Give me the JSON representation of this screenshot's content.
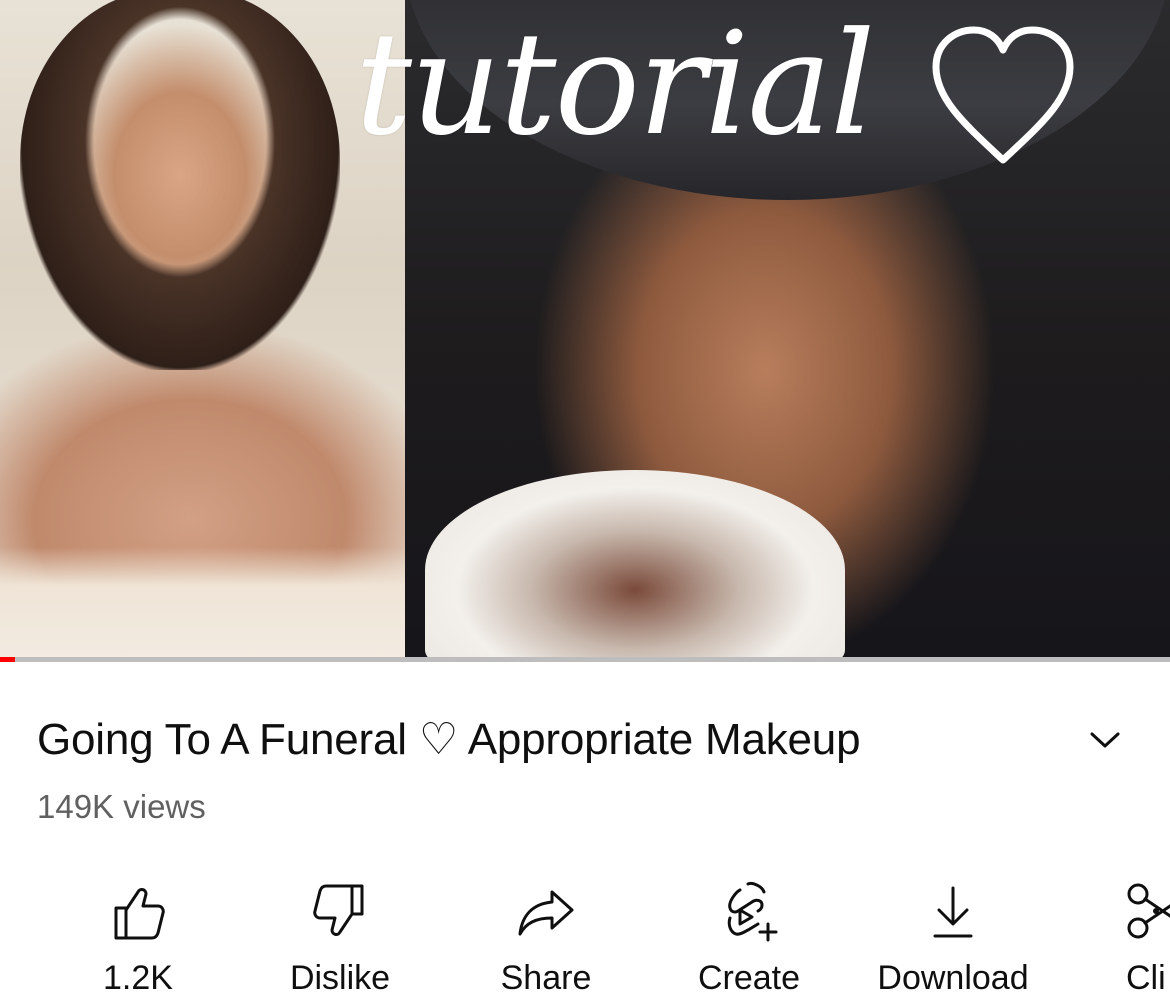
{
  "player": {
    "overlay_title": "tutorial",
    "progress_fraction": 0.013,
    "progress_color": "#ff0000"
  },
  "video": {
    "title": "Going To A Funeral ♡ Appropriate Makeup",
    "views": "149K views"
  },
  "actions": [
    {
      "id": "like",
      "icon": "thumbs-up-icon",
      "label": "1.2K"
    },
    {
      "id": "dislike",
      "icon": "thumbs-down-icon",
      "label": "Dislike"
    },
    {
      "id": "share",
      "icon": "share-arrow-icon",
      "label": "Share"
    },
    {
      "id": "create",
      "icon": "create-remix-icon",
      "label": "Create"
    },
    {
      "id": "download",
      "icon": "download-icon",
      "label": "Download"
    },
    {
      "id": "clip",
      "icon": "scissors-icon",
      "label": "Cli"
    }
  ],
  "colors": {
    "text_primary": "#0f0f0f",
    "text_secondary": "#606060",
    "background": "#ffffff"
  }
}
